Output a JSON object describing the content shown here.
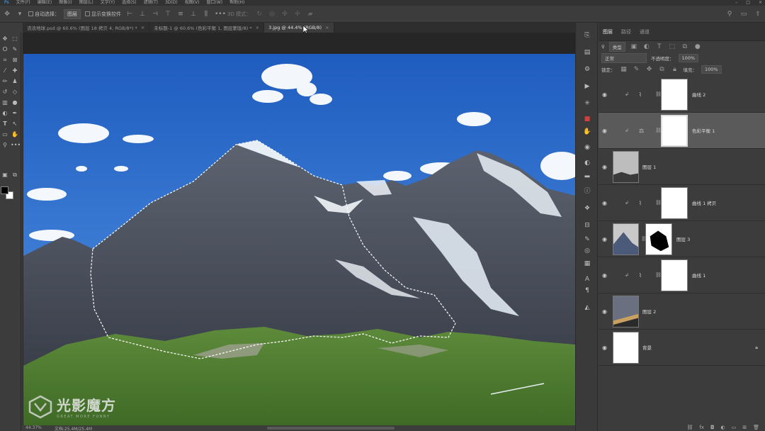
{
  "menu": [
    "文件(F)",
    "编辑(E)",
    "图像(I)",
    "图层(L)",
    "文字(Y)",
    "选择(S)",
    "滤镜(T)",
    "3D(D)",
    "视图(V)",
    "窗口(W)",
    "帮助(H)"
  ],
  "options": {
    "auto_select_label": "自动选择：",
    "auto_select_value": "图层",
    "show_transform_label": "显示变换控件",
    "mode_3d_label": "3D 模式："
  },
  "tabs": [
    {
      "label": "流浪地球.psd @ 60.6% (图层 18 拷贝 4, RGB/8*) *",
      "close": "×"
    },
    {
      "label": "未标题-1 @ 60.6% (色彩平衡 1, 图层蒙版/8) *",
      "close": "×"
    },
    {
      "label": "3.jpg @ 44.4% (RGB/8)",
      "close": "×"
    }
  ],
  "panel": {
    "tabs": [
      "图层",
      "路径",
      "通道"
    ],
    "filter_kind": "类型",
    "blend_mode": "正常",
    "opacity_label": "不透明度：",
    "opacity_value": "100%",
    "lock_label": "锁定：",
    "fill_label": "填充：",
    "fill_value": "100%"
  },
  "layers": [
    {
      "name": "曲线 2"
    },
    {
      "name": "色彩平衡 1"
    },
    {
      "name": "图层 1"
    },
    {
      "name": "曲线 1 拷贝"
    },
    {
      "name": "图层 3"
    },
    {
      "name": "曲线 1"
    },
    {
      "name": "图层 2"
    },
    {
      "name": "背景"
    }
  ],
  "status": {
    "zoom": "44.37%",
    "doc": "文档:25.4M/25.4M"
  },
  "watermark": {
    "title": "光影魔方",
    "subtitle": "GREAT MORE FUNNY"
  }
}
